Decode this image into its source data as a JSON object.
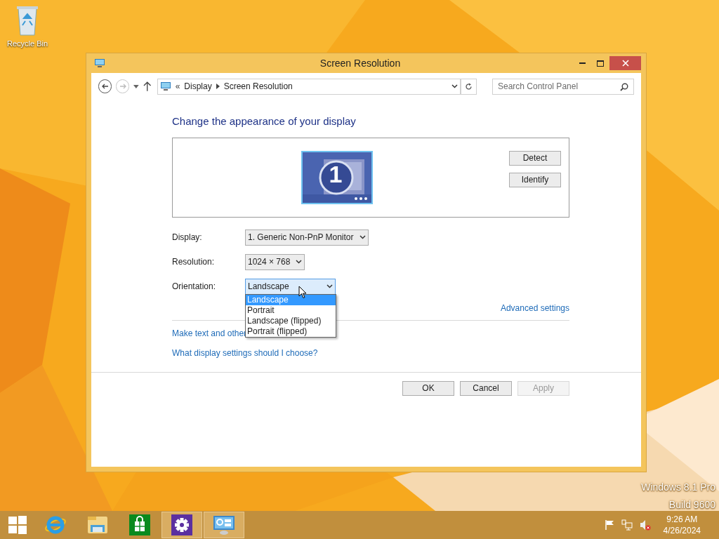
{
  "desktop": {
    "icons": [
      {
        "label": "Recycle Bin"
      }
    ],
    "watermark": [
      "Windows 8.1 Pro",
      "Build 9600"
    ]
  },
  "window": {
    "title": "Screen Resolution"
  },
  "address_bar": {
    "overflow": "«",
    "path": [
      "Display",
      "Screen Resolution"
    ]
  },
  "search": {
    "placeholder": "Search Control Panel"
  },
  "heading": "Change the appearance of your display",
  "monitor": {
    "label": "1"
  },
  "monitor_buttons": [
    "Detect",
    "Identify"
  ],
  "fields": [
    {
      "label": "Display:",
      "value": "1. Generic Non-PnP Monitor",
      "open": false
    },
    {
      "label": "Resolution:",
      "value": "1024 × 768",
      "open": false
    },
    {
      "label": "Orientation:",
      "value": "Landscape",
      "open": true
    }
  ],
  "dropdown_options": [
    {
      "label": "Landscape",
      "selected": true
    },
    {
      "label": "Portrait",
      "selected": false
    },
    {
      "label": "Landscape (flipped)",
      "selected": false
    },
    {
      "label": "Portrait (flipped)",
      "selected": false
    }
  ],
  "advanced_link": "Advanced settings",
  "links": [
    "Make text and other",
    "What display settings should I choose?"
  ],
  "dialog_buttons": [
    {
      "label": "OK",
      "disabled": false
    },
    {
      "label": "Cancel",
      "disabled": false
    },
    {
      "label": "Apply",
      "disabled": true
    }
  ],
  "taskbar": {
    "apps": [
      {
        "kind": "ie",
        "selected": false
      },
      {
        "kind": "explorer",
        "selected": false
      },
      {
        "kind": "store",
        "selected": false
      },
      {
        "kind": "settings",
        "selected": true
      },
      {
        "kind": "control",
        "selected": true
      }
    ],
    "time": "9:26 AM",
    "date": "4/26/2024"
  }
}
